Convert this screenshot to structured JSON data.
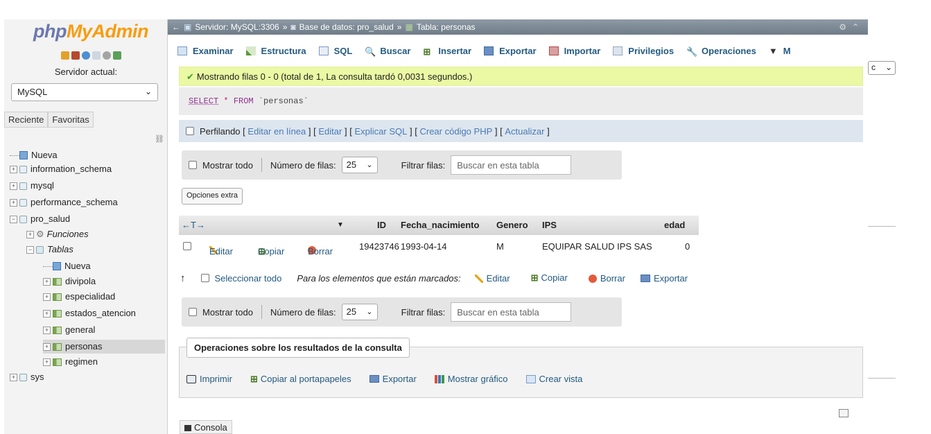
{
  "sidebar": {
    "logo": {
      "php": "php",
      "my": "My",
      "admin": "Admin"
    },
    "server_label": "Servidor actual:",
    "server_value": "MySQL",
    "tab_recent": "Reciente",
    "tab_favorites": "Favoritas",
    "tree": {
      "nueva": "Nueva",
      "db1": "information_schema",
      "db2": "mysql",
      "db3": "performance_schema",
      "db4": "pro_salud",
      "funciones": "Funciones",
      "tablas": "Tablas",
      "t_nueva": "Nueva",
      "t1": "divipola",
      "t2": "especialidad",
      "t3": "estados_atencion",
      "t4": "general",
      "t5": "personas",
      "t6": "regimen",
      "db5": "sys"
    }
  },
  "breadcrumb": {
    "server": "Servidor: MySQL:3306",
    "database": "Base de datos: pro_salud",
    "table": "Tabla: personas",
    "sep": "»"
  },
  "menu": {
    "examinar": "Examinar",
    "estructura": "Estructura",
    "sql": "SQL",
    "buscar": "Buscar",
    "insertar": "Insertar",
    "exportar": "Exportar",
    "importar": "Importar",
    "privilegios": "Privilegios",
    "operaciones": "Operaciones",
    "mas": "M"
  },
  "success_message": "Mostrando filas 0 - 0 (total de 1, La consulta tardó 0,0031 segundos.)",
  "sql": {
    "select": "SELECT",
    "star": "*",
    "from": "FROM",
    "table": "`personas`"
  },
  "profiling": {
    "label": "Perfilando",
    "editar_linea": "Editar en línea",
    "editar": "Editar",
    "explicar": "Explicar SQL",
    "crear_php": "Crear código PHP",
    "actualizar": "Actualizar",
    "lb": "[",
    "rb": "]"
  },
  "nav": {
    "show_all": "Mostrar todo",
    "rows_label": "Número de filas:",
    "rows_value": "25",
    "filter_label": "Filtrar filas:",
    "filter_placeholder": "Buscar en esta tabla"
  },
  "extra_options": "Opciones extra",
  "table": {
    "arrows": "←T→",
    "sort_icon": "▼",
    "columns": [
      "ID",
      "Fecha_nacimiento",
      "Genero",
      "IPS",
      "edad"
    ],
    "row": {
      "editar": "Editar",
      "copiar": "Copiar",
      "borrar": "Borrar",
      "id": "19423746",
      "fecha": "1993-04-14",
      "genero": "M",
      "ips": "EQUIPAR SALUD IPS SAS",
      "edad": "0"
    }
  },
  "bulk": {
    "select_all": "Seleccionar todo",
    "marked_label": "Para los elementos que están marcados:",
    "editar": "Editar",
    "copiar": "Copiar",
    "borrar": "Borrar",
    "exportar": "Exportar"
  },
  "ops": {
    "title": "Operaciones sobre los resultados de la consulta",
    "imprimir": "Imprimir",
    "copiar": "Copiar al portapapeles",
    "exportar": "Exportar",
    "grafico": "Mostrar gráfico",
    "vista": "Crear vista"
  },
  "console": "Consola",
  "right_select": "c"
}
